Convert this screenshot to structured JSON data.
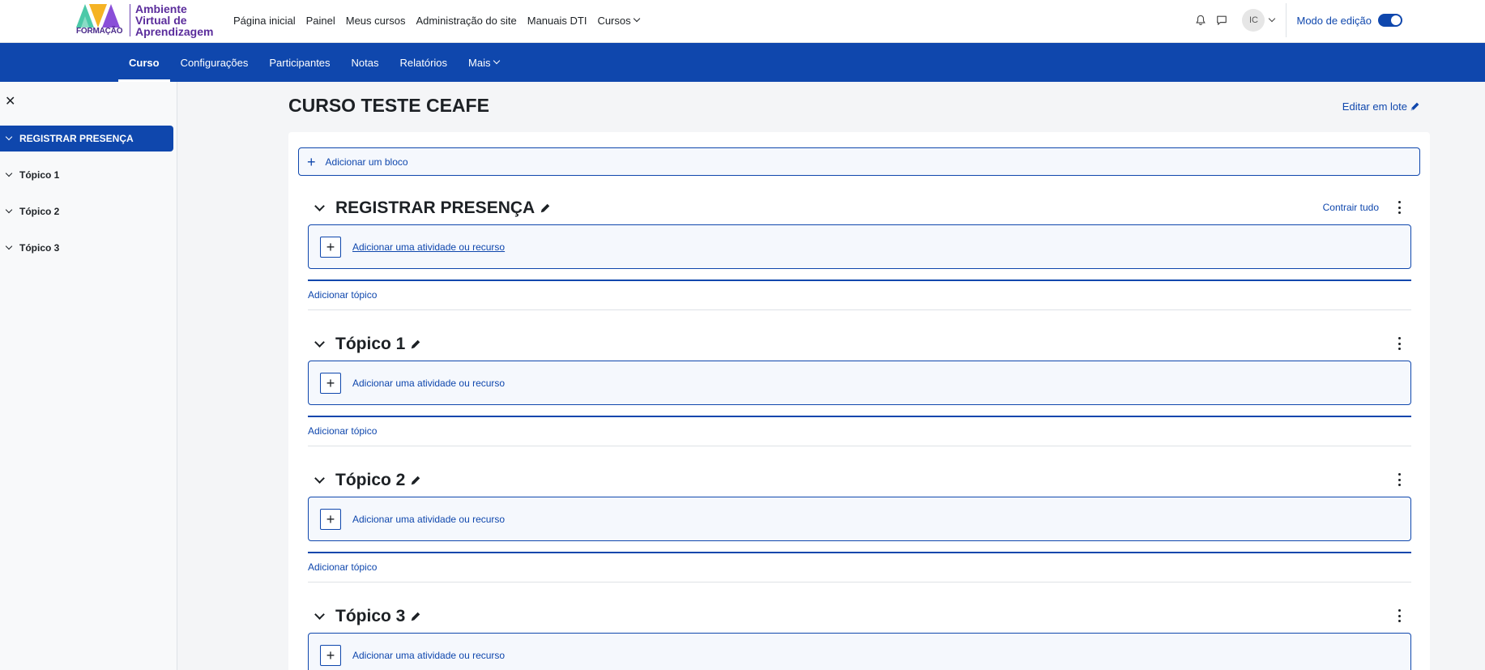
{
  "logo": {
    "mark_text": "AVA",
    "subtitle": "FORMAÇÃO",
    "line1": "Ambiente",
    "line2": "Virtual de",
    "line3": "Aprendizagem"
  },
  "primary_nav": [
    {
      "label": "Página inicial"
    },
    {
      "label": "Painel"
    },
    {
      "label": "Meus cursos"
    },
    {
      "label": "Administração do site"
    },
    {
      "label": "Manuais DTI"
    },
    {
      "label": "Cursos"
    }
  ],
  "user": {
    "initials": "IC"
  },
  "edit_mode": {
    "label": "Modo de edição",
    "enabled": true
  },
  "secondary_nav": [
    {
      "label": "Curso"
    },
    {
      "label": "Configurações"
    },
    {
      "label": "Participantes"
    },
    {
      "label": "Notas"
    },
    {
      "label": "Relatórios"
    },
    {
      "label": "Mais"
    }
  ],
  "course_index": {
    "close_glyph": "✕",
    "items": [
      {
        "label": "REGISTRAR PRESENÇA"
      },
      {
        "label": "Tópico 1"
      },
      {
        "label": "Tópico 2"
      },
      {
        "label": "Tópico 3"
      }
    ]
  },
  "page": {
    "title": "CURSO TESTE CEAFE",
    "bulk_edit": "Editar em lote",
    "add_block": "Adicionar um bloco",
    "collapse_all": "Contrair tudo"
  },
  "sections": [
    {
      "title": "REGISTRAR PRESENÇA",
      "add_activity": "Adicionar uma atividade ou recurso",
      "add_topic": "Adicionar tópico"
    },
    {
      "title": "Tópico 1",
      "add_activity": "Adicionar uma atividade ou recurso",
      "add_topic": "Adicionar tópico"
    },
    {
      "title": "Tópico 2",
      "add_activity": "Adicionar uma atividade ou recurso",
      "add_topic": "Adicionar tópico"
    },
    {
      "title": "Tópico 3",
      "add_activity": "Adicionar uma atividade ou recurso"
    }
  ],
  "colors": {
    "primary": "#0f47ad",
    "logo_purple": "#5b2d9c",
    "page_bg": "#f4f5f7"
  }
}
